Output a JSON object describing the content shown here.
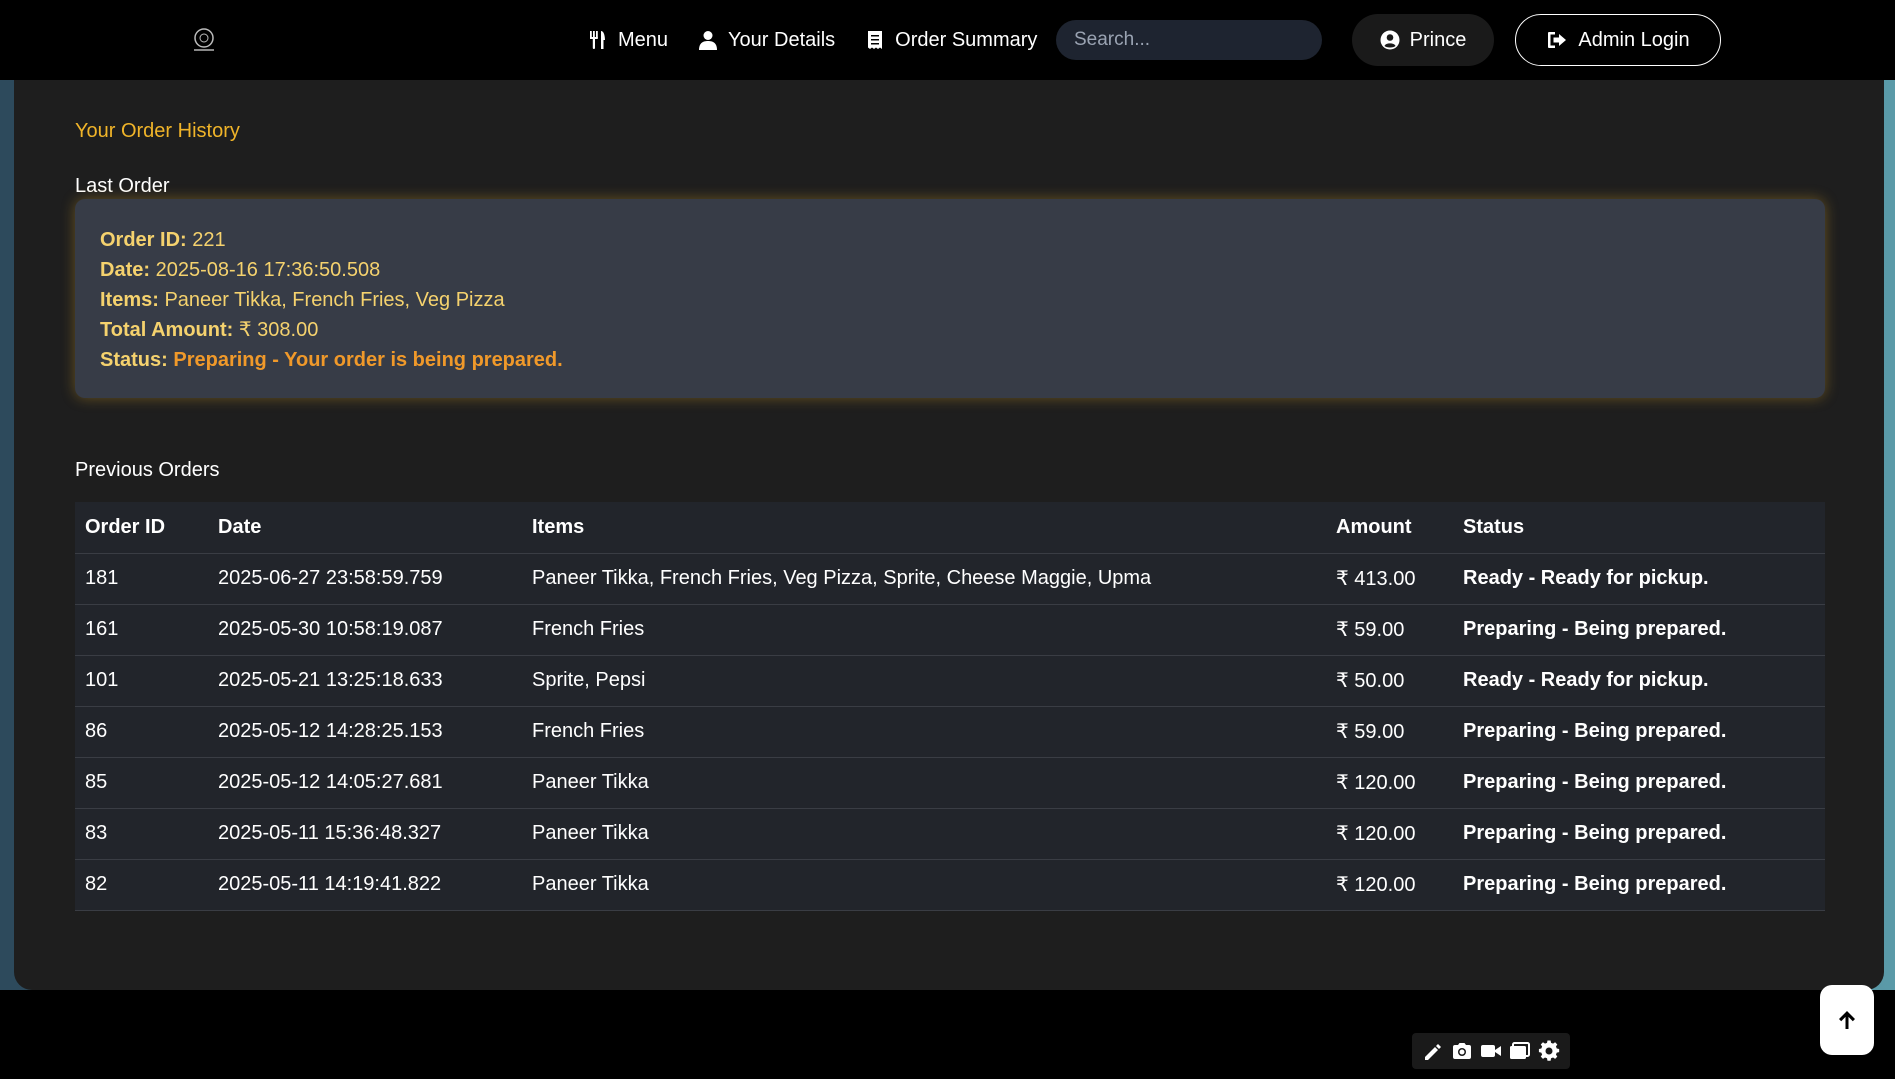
{
  "nav": {
    "logo_icon": "restaurant-logo",
    "links": [
      {
        "label": "Menu",
        "icon": "utensils-icon"
      },
      {
        "label": "Your Details",
        "icon": "user-icon"
      },
      {
        "label": "Order Summary",
        "icon": "receipt-icon"
      }
    ],
    "search_placeholder": "Search...",
    "user_label": "Prince",
    "admin_label": "Admin Login"
  },
  "history": {
    "title": "Your Order History",
    "last_order_heading": "Last Order",
    "last_order": {
      "id_label": "Order ID:",
      "id": "221",
      "date_label": "Date:",
      "date": "2025-08-16 17:36:50.508",
      "items_label": "Items:",
      "items": "Paneer Tikka, French Fries, Veg Pizza",
      "total_label": "Total Amount:",
      "total": "₹ 308.00",
      "status_label": "Status:",
      "status": "Preparing - Your order is being prepared."
    },
    "previous_heading": "Previous Orders",
    "columns": [
      "Order ID",
      "Date",
      "Items",
      "Amount",
      "Status"
    ],
    "rows": [
      {
        "id": "181",
        "date": "2025-06-27 23:58:59.759",
        "items": "Paneer Tikka, French Fries, Veg Pizza, Sprite, Cheese Maggie, Upma",
        "amount": "₹ 413.00",
        "status": "Ready - Ready for pickup.",
        "status_type": "ready"
      },
      {
        "id": "161",
        "date": "2025-05-30 10:58:19.087",
        "items": "French Fries",
        "amount": "₹ 59.00",
        "status": "Preparing - Being prepared.",
        "status_type": "preparing"
      },
      {
        "id": "101",
        "date": "2025-05-21 13:25:18.633",
        "items": "Sprite, Pepsi",
        "amount": "₹ 50.00",
        "status": "Ready - Ready for pickup.",
        "status_type": "ready"
      },
      {
        "id": "86",
        "date": "2025-05-12 14:28:25.153",
        "items": "French Fries",
        "amount": "₹ 59.00",
        "status": "Preparing - Being prepared.",
        "status_type": "preparing"
      },
      {
        "id": "85",
        "date": "2025-05-12 14:05:27.681",
        "items": "Paneer Tikka",
        "amount": "₹ 120.00",
        "status": "Preparing - Being prepared.",
        "status_type": "preparing"
      },
      {
        "id": "83",
        "date": "2025-05-11 15:36:48.327",
        "items": "Paneer Tikka",
        "amount": "₹ 120.00",
        "status": "Preparing - Being prepared.",
        "status_type": "preparing"
      },
      {
        "id": "82",
        "date": "2025-05-11 14:19:41.822",
        "items": "Paneer Tikka",
        "amount": "₹ 120.00",
        "status": "Preparing - Being prepared.",
        "status_type": "preparing"
      }
    ]
  },
  "colors": {
    "accent": "#f0b429",
    "status_ready": "#2e8fe0",
    "status_preparing": "#f0992a"
  }
}
